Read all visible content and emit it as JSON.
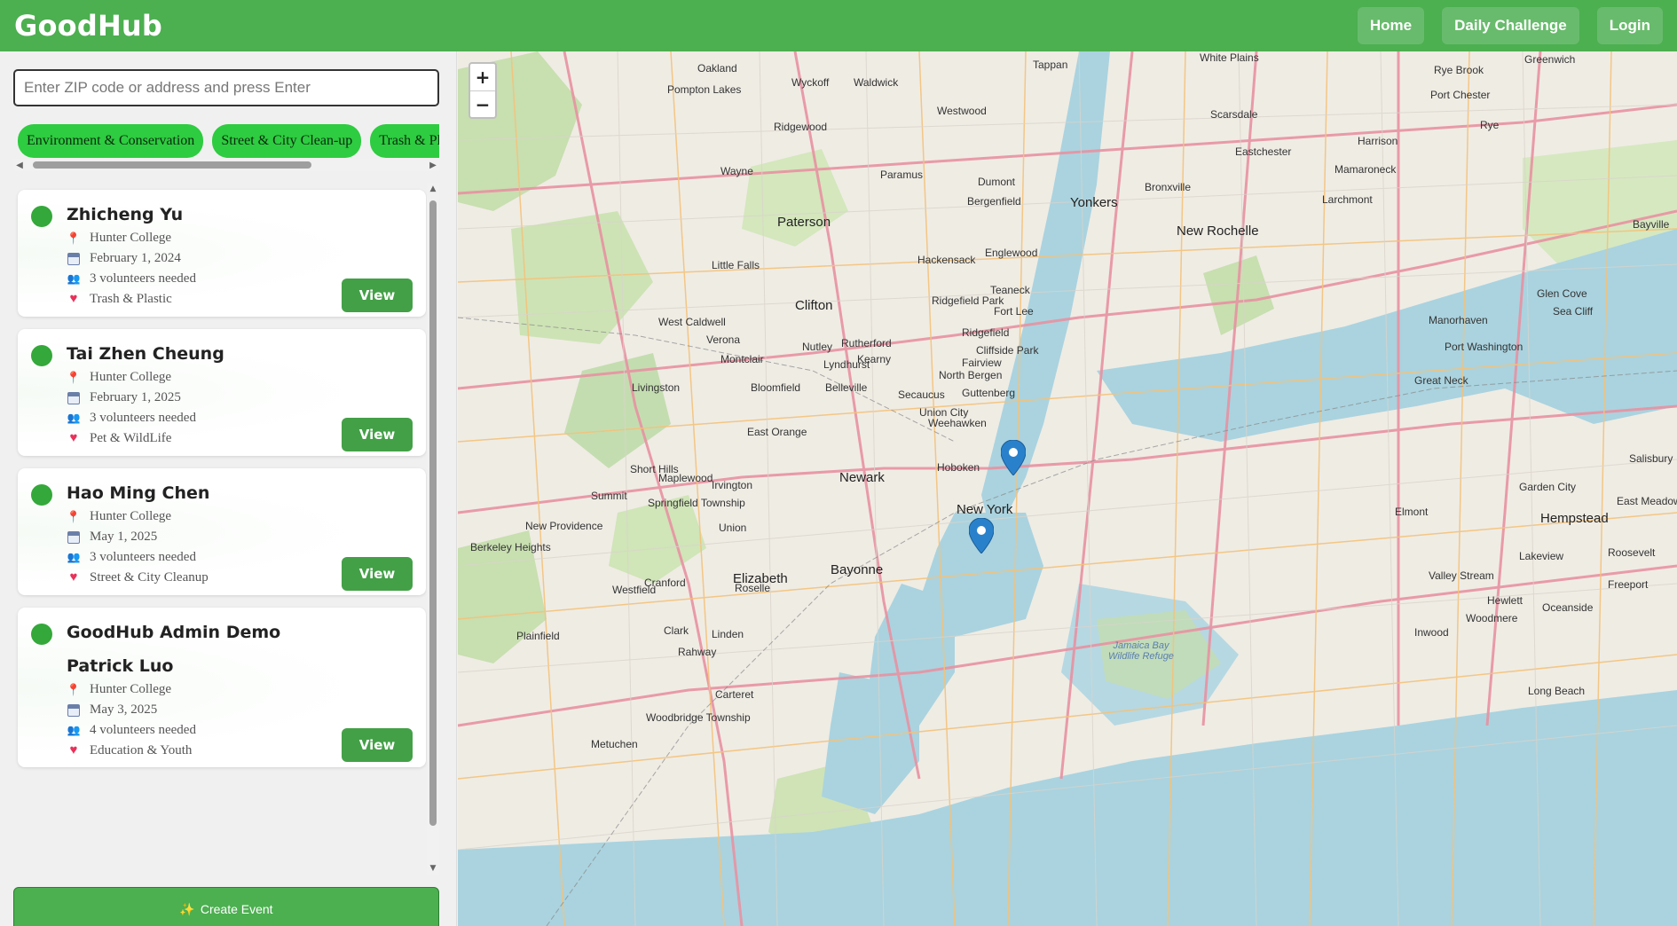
{
  "app": {
    "title": "GoodHub"
  },
  "nav": {
    "home": "Home",
    "daily_challenge": "Daily Challenge",
    "login": "Login"
  },
  "search": {
    "placeholder": "Enter ZIP code or address and press Enter",
    "value": ""
  },
  "categories": [
    {
      "label": "Environment & Conservation"
    },
    {
      "label": "Street & City Clean-up"
    },
    {
      "label": "Trash & Plastic"
    }
  ],
  "events": [
    {
      "title": "Zhicheng Yu",
      "location": "Hunter College",
      "date": "February 1, 2024",
      "volunteers": "3 volunteers needed",
      "category": "Trash & Plastic",
      "view": "View"
    },
    {
      "title": "Tai Zhen Cheung",
      "location": "Hunter College",
      "date": "February 1, 2025",
      "volunteers": "3 volunteers needed",
      "category": "Pet & WildLife",
      "view": "View"
    },
    {
      "title": "Hao Ming Chen",
      "location": "Hunter College",
      "date": "May 1, 2025",
      "volunteers": "3 volunteers needed",
      "category": "Street & City Cleanup",
      "view": "View"
    },
    {
      "title": "GoodHub Admin Demo",
      "subtitle": "Patrick Luo",
      "location": "Hunter College",
      "date": "May 3, 2025",
      "volunteers": "4 volunteers needed",
      "category": "Education & Youth",
      "view": "View"
    }
  ],
  "create_event": {
    "icon": "✨",
    "label": "Create Event"
  },
  "map": {
    "zoom_in": "+",
    "zoom_out": "−",
    "labels": {
      "white_plains": "White Plains",
      "yonkers": "Yonkers",
      "new_rochelle": "New Rochelle",
      "paterson": "Paterson",
      "clifton": "Clifton",
      "newark": "Newark",
      "new_york": "New York",
      "bayonne": "Bayonne",
      "elizabeth": "Elizabeth",
      "hempstead": "Hempstead",
      "long_beach": "Long Beach",
      "jamaica_bay": "Jamaica Bay Wildlife Refuge",
      "hoboken": "Hoboken",
      "englewood": "Englewood",
      "fort_lee": "Fort Lee",
      "hackensack": "Hackensack",
      "union_city": "Union City",
      "great_neck": "Great Neck",
      "glen_cove": "Glen Cove",
      "oakland": "Oakland",
      "wayne": "Wayne",
      "montclair": "Montclair",
      "livingston": "Livingston",
      "summit": "Summit",
      "plainfield": "Plainfield",
      "linden": "Linden",
      "rahway": "Rahway",
      "westfield": "Westfield",
      "freeport": "Freeport",
      "valley_stream": "Valley Stream",
      "garden_city": "Garden City",
      "port_washington": "Port Washington",
      "rye": "Rye",
      "larchmont": "Larchmont",
      "bronxville": "Bronxville",
      "ridgewood": "Ridgewood",
      "paramus": "Paramus",
      "teaneck": "Teaneck",
      "maplewood": "Maplewood",
      "irvington": "Irvington",
      "kearny": "Kearny",
      "belleville": "Belleville",
      "nutley": "Nutley",
      "cranford": "Cranford",
      "carteret": "Carteret",
      "woodbridge": "Woodbridge Township",
      "metuchen": "Metuchen",
      "oceanside": "Oceanside",
      "woodmere": "Woodmere",
      "inwood": "Inwood",
      "hewlett": "Hewlett",
      "elmont": "Elmont",
      "lakeview": "Lakeview",
      "roosevelt": "Roosevelt",
      "salisbury": "Salisbury",
      "east_meadow": "East Meadow",
      "sea_cliff": "Sea Cliff",
      "manorhaven": "Manorhaven",
      "bayville": "Bayville",
      "harrison": "Harrison",
      "scarsdale": "Scarsdale",
      "eastchester": "Eastchester",
      "mamaroneck": "Mamaroneck",
      "rye_brook": "Rye Brook",
      "port_chester": "Port Chester",
      "greenwich": "Greenwich",
      "tappan": "Tappan",
      "wyckoff": "Wyckoff",
      "waldwick": "Waldwick",
      "westwood": "Westwood",
      "dumont": "Dumont",
      "bergenfield": "Bergenfield",
      "pompton_lakes": "Pompton Lakes",
      "little_falls": "Little Falls",
      "west_caldwell": "West Caldwell",
      "verona": "Verona",
      "east_orange": "East Orange",
      "short_hills": "Short Hills",
      "springfield": "Springfield Township",
      "union": "Union",
      "new_providence": "New Providence",
      "berkeley_heights": "Berkeley Heights",
      "clark": "Clark",
      "roselle": "Roselle",
      "bloomfield": "Bloomfield",
      "rutherford": "Rutherford",
      "lyndhurst": "Lyndhurst",
      "secaucus": "Secaucus",
      "weehawken": "Weehawken",
      "north_bergen": "North Bergen",
      "guttenberg": "Guttenberg",
      "fairview": "Fairview",
      "cliffside_park": "Cliffside Park",
      "ridgefield": "Ridgefield",
      "ridgefield_park": "Ridgefield Park"
    }
  }
}
